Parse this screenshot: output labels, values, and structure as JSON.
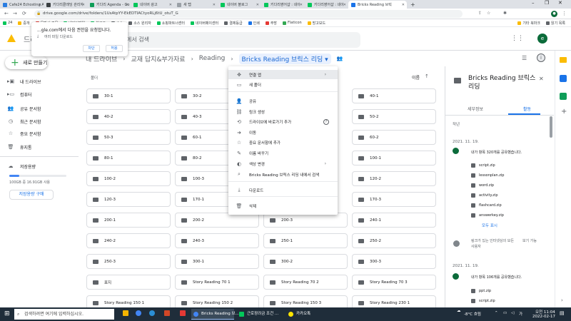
{
  "browser": {
    "tabs": [
      {
        "label": "Cafe24 Echosting Ad",
        "color": "#2a7de1"
      },
      {
        "label": "키다리클래딩 관리자",
        "color": "#3c4043"
      },
      {
        "label": "키다리 Agenda - Go",
        "color": "#0f9d58"
      },
      {
        "label": "네이버 광고",
        "color": "#03c75a"
      },
      {
        "label": "새 탭",
        "color": "#9aa0a6"
      },
      {
        "label": "네이버 블로그",
        "color": "#03c75a"
      },
      {
        "label": "키다리영어샵 : 네이",
        "color": "#03c75a"
      },
      {
        "label": "키다리영어샵 : 네이",
        "color": "#03c75a"
      },
      {
        "label": "Bricks Reading 브릭",
        "color": "#1a73e8"
      }
    ],
    "url": "drive.google.com/drive/folders/1UsAtpYY-EkEDTIACtyoRLj6tU_otuT_G",
    "bookmarks": [
      "24",
      "중개",
      "물판사 주문",
      "네이버메일",
      "블로그",
      "소스",
      "소스 원리자",
      "쇼핑파트너센터",
      "네이버페이센터",
      "결제등급",
      "인쇄",
      "주방",
      "Flaticon",
      "망고보드",
      "기타 북마크",
      "읽기 목록"
    ]
  },
  "drive": {
    "logo_text": "드라",
    "search_placeholder": "에서 검색",
    "new_button": "새로 만들기",
    "nav": [
      "내 드라이브",
      "컴퓨터",
      "공유 문서함",
      "최근 문서함",
      "중요 문서함",
      "휴지통"
    ],
    "storage_label": "저장용량",
    "storage_text": "100GB 중 16.91GB 사용",
    "storage_fraction": 0.169,
    "buy_storage": "저장용량 구매",
    "breadcrumb": [
      "내 드라이브",
      "교재 답지&부가자료",
      "Reading",
      "Bricks Reading 브릭스 리딩"
    ],
    "section_label": "폴더",
    "sort_label": "이름",
    "folders": [
      "30-1",
      "30-2",
      "",
      "40-1",
      "40-2",
      "40-3",
      "",
      "50-2",
      "50-3",
      "60-1",
      "",
      "60-2",
      "80-1",
      "80-2",
      "",
      "100-1",
      "100-2",
      "100-3",
      "",
      "120-2",
      "120-3",
      "170-1",
      "",
      "170-3",
      "200-1",
      "200-2",
      "200-3",
      "240-1",
      "240-2",
      "240-3",
      "250-1",
      "250-2",
      "250-3",
      "300-1",
      "300-2",
      "300-3",
      "표지",
      "Story Reading 70 1",
      "Story Reading 70 2",
      "Story Reading 70 3",
      "Story Reading 150 1",
      "Story Reading 150 2",
      "Story Reading 150 3",
      "Story Reading 230 1"
    ]
  },
  "popup": {
    "title": "...gle.com에서 다음 권한을 요청합니다.",
    "item": "여러 파일 다운로드",
    "deny": "차단",
    "allow": "허용"
  },
  "context_menu": {
    "items": [
      {
        "label": "연결 앱",
        "icon": "move-icon",
        "submenu": true
      },
      {
        "label": "새 폴더",
        "icon": "new-folder-icon"
      },
      {
        "label": "공유",
        "icon": "share-person-icon"
      },
      {
        "label": "링크 생성",
        "icon": "link-icon"
      },
      {
        "label": "드라이브에 바로가기 추가",
        "icon": "shortcut-icon",
        "help": true
      },
      {
        "label": "이동",
        "icon": "move-folder-icon"
      },
      {
        "label": "중요 문서함에 추가",
        "icon": "star-icon"
      },
      {
        "label": "이름 바꾸기",
        "icon": "edit-icon"
      },
      {
        "label": "색상 변경",
        "icon": "palette-icon",
        "submenu": true
      },
      {
        "label": "Bricks Reading 브릭스 리딩 내에서 검색",
        "icon": "search-icon"
      },
      {
        "label": "다운로드",
        "icon": "download-icon"
      },
      {
        "label": "삭제",
        "icon": "trash-icon"
      }
    ]
  },
  "details": {
    "title": "Bricks Reading 브릭스 리딩",
    "tab_details": "세부정보",
    "tab_activity": "활동",
    "period": "작년",
    "date1": "2021. 11. 19.",
    "share1": "내가 항목 320개를 공유했습니다.",
    "files1": [
      "script.zip",
      "lessonplan.zip",
      "word.zip",
      "activity.zip",
      "flashcard.zip",
      "answerkey.zip"
    ],
    "show_all": "모두 표시",
    "link_text": "링크가 있는 인터넷상의 모든 사용자",
    "link_perm": "보기 가능",
    "date2": "2021. 11. 19.",
    "share2": "내가 항목 106개를 공유했습니다.",
    "files2": [
      "ppt.zip",
      "script.zip"
    ]
  },
  "taskbar": {
    "search": "검색하려면 여기에 입력하십시오.",
    "app1": "Bricks Reading 브...",
    "app2": "근로장려금 조건 ...",
    "app3": "카카오톡",
    "weather": "-8°C 흐림",
    "time": "오전 11:04",
    "date": "2022-02-17"
  }
}
